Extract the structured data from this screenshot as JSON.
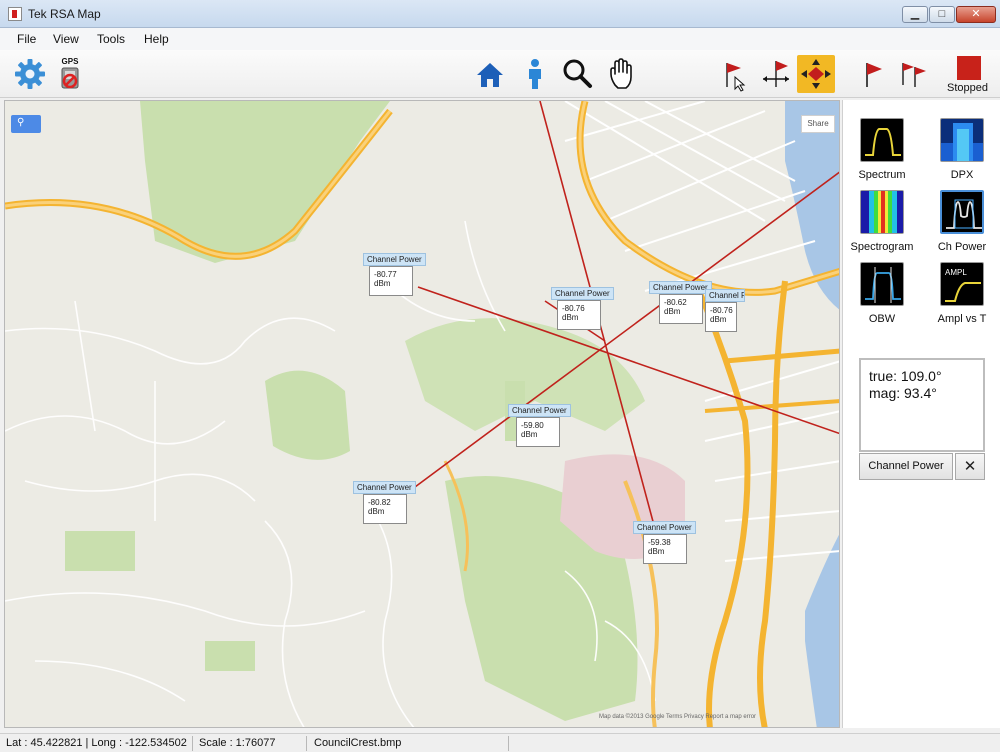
{
  "window": {
    "title": "Tek RSA Map",
    "controls": {
      "minimize": "▁",
      "maximize": "□",
      "close": "✕"
    }
  },
  "menu": [
    "File",
    "View",
    "Tools",
    "Help"
  ],
  "toolbar": {
    "left_tools": [
      "settings-gear-icon",
      "gps-disabled-icon"
    ],
    "gps_label": "GPS",
    "center_tools": [
      "home-icon",
      "person-icon",
      "magnifier-icon",
      "hand-pan-icon"
    ],
    "right_tools": [
      "flag-cursor-icon",
      "flag-measure-icon",
      "move-arrows-icon",
      "flag-icon",
      "multi-flag-icon",
      "stop-icon"
    ],
    "stopped_label": "Stopped",
    "active_tool": "move-arrows-icon",
    "accent_color": "#f2b824"
  },
  "map": {
    "measurements": [
      {
        "title": "Channel Power",
        "value": "-80.77",
        "unit": "dBm"
      },
      {
        "title": "Channel Power",
        "value": "-80.76",
        "unit": "dBm"
      },
      {
        "title": "Channel Power",
        "value": "-80.62",
        "unit": "dBm"
      },
      {
        "title": "Channel Power",
        "value": "-80.76",
        "unit": "dBm"
      },
      {
        "title": "Channel Power",
        "value": "-59.80",
        "unit": "dBm"
      },
      {
        "title": "Channel Power",
        "value": "-80.82",
        "unit": "dBm"
      },
      {
        "title": "Channel Power",
        "value": "-59.38",
        "unit": "dBm"
      }
    ],
    "share_label": "Share",
    "footer_text": "Map data ©2013 Google   Terms   Privacy   Report a map error"
  },
  "panel": {
    "measurements": [
      {
        "label": "Spectrum",
        "icon": "spectrum-icon"
      },
      {
        "label": "DPX",
        "icon": "dpx-icon"
      },
      {
        "label": "Spectrogram",
        "icon": "spectrogram-icon"
      },
      {
        "label": "Ch Power",
        "icon": "ch-power-icon"
      },
      {
        "label": "OBW",
        "icon": "obw-icon"
      },
      {
        "label": "Ampl vs T",
        "icon": "ampl-vs-t-icon"
      }
    ],
    "ampl_icon_text": "AMPL",
    "bearing": {
      "true": "true: 109.0°",
      "mag": "mag: 93.4°"
    },
    "active_measurement": "Channel Power",
    "close_symbol": "✕"
  },
  "status": {
    "latlong": "Lat : 45.422821 | Long : -122.534502",
    "scale": "Scale : 1:76077",
    "file": "CouncilCrest.bmp"
  }
}
